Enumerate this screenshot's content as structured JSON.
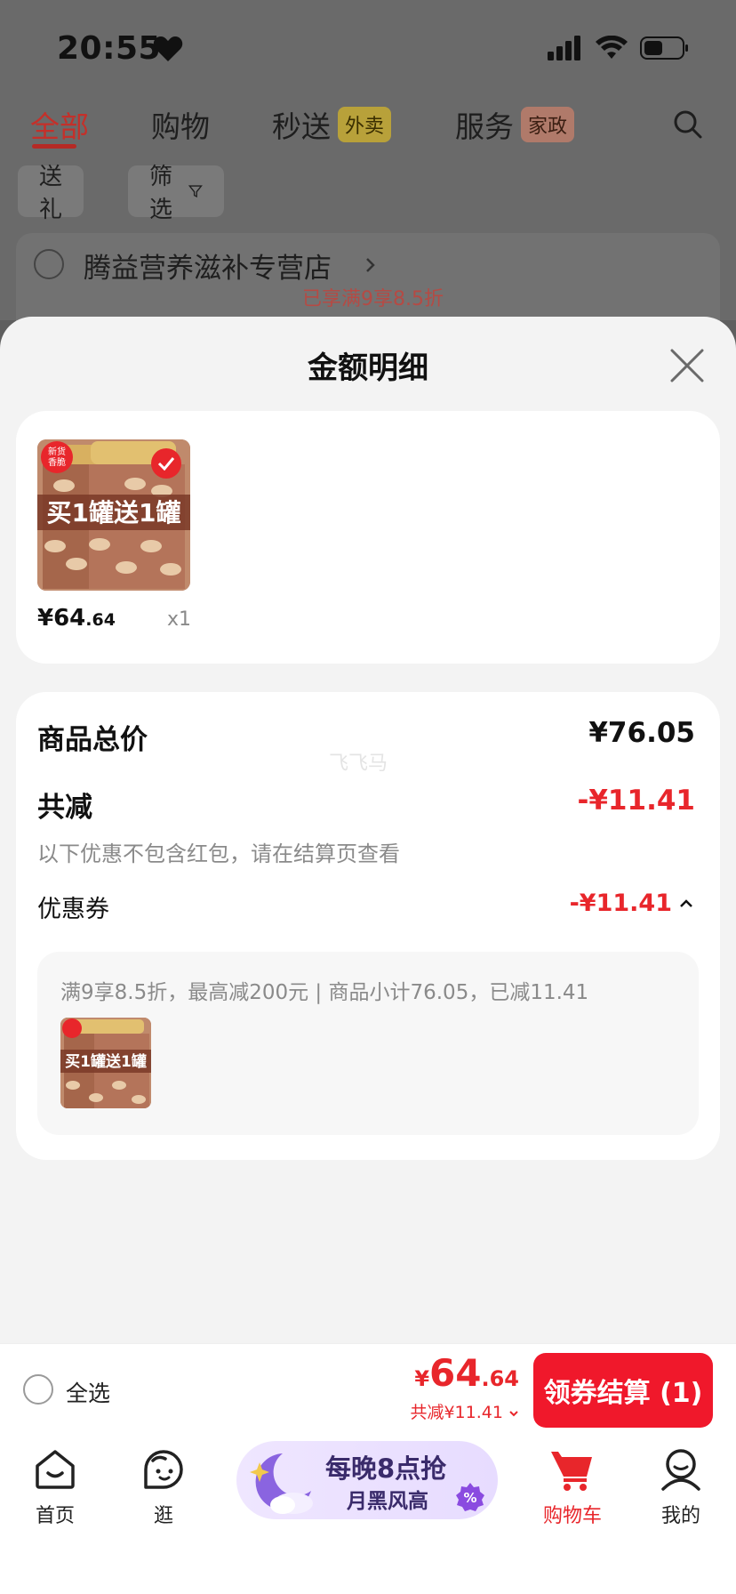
{
  "status": {
    "time": "20:55"
  },
  "tabs": [
    {
      "label": "全部"
    },
    {
      "label": "购物"
    },
    {
      "label": "秒送",
      "badge": "外卖"
    },
    {
      "label": "服务",
      "badge": "家政"
    }
  ],
  "filters": [
    {
      "label": "送礼"
    },
    {
      "label": "筛选"
    }
  ],
  "store": {
    "name": "腾益营养滋补专营店",
    "sub": "已享满9享8.5折"
  },
  "sheet": {
    "title": "金额明细",
    "watermark": "飞飞马"
  },
  "product": {
    "image_text_top": "新货香脆",
    "image_text_main": "买1罐送1罐",
    "price_symbol": "¥",
    "price_int": "64",
    "price_dec": ".64",
    "quantity": "x1"
  },
  "detail": {
    "total_label": "商品总价",
    "total_value": "¥76.05",
    "discount_label": "共减",
    "discount_value": "-¥11.41",
    "hint": "以下优惠不包含红包，请在结算页查看",
    "coupon_label": "优惠券",
    "coupon_value": "-¥11.41",
    "coupon_desc": "满9享8.5折，最高减200元 | 商品小计76.05，已减11.41"
  },
  "checkout": {
    "select_all": "全选",
    "price_symbol": "¥",
    "price_int": "64",
    "price_dec": ".64",
    "discount": "共减¥11.41",
    "button": "领券结算 (1)"
  },
  "nav": {
    "home": "首页",
    "browse": "逛",
    "promo_line1": "每晚8点抢",
    "promo_line2": "月黑风高",
    "cart": "购物车",
    "mine": "我的"
  },
  "colors": {
    "accent_red": "#e8262b",
    "checkout_red": "#f0182b",
    "promo_purple": "#3a2b6b"
  }
}
